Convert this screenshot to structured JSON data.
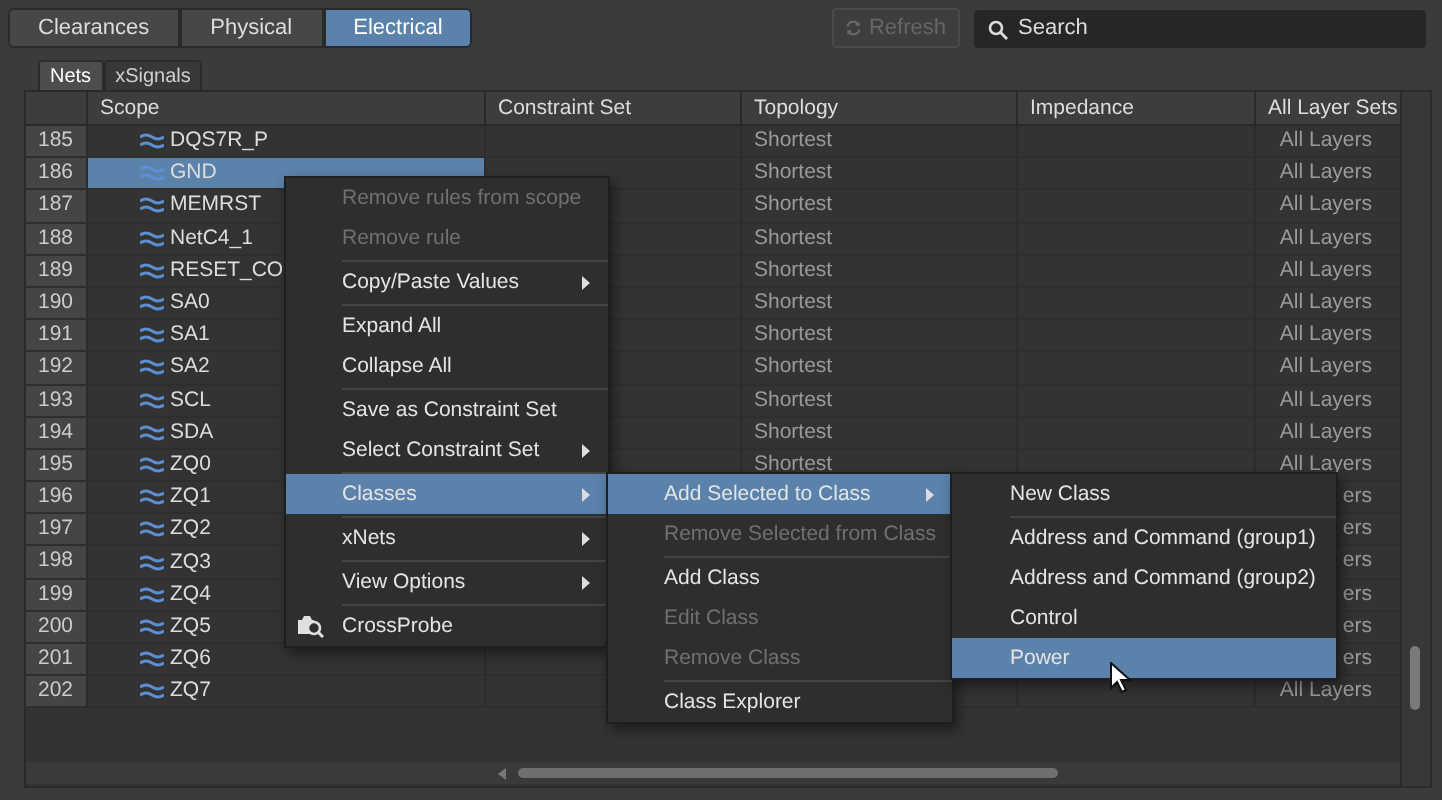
{
  "view_tabs": [
    {
      "label": "Clearances",
      "selected": false
    },
    {
      "label": "Physical",
      "selected": false
    },
    {
      "label": "Electrical",
      "selected": true
    }
  ],
  "refresh_button": {
    "label": "Refresh",
    "disabled": true
  },
  "search": {
    "placeholder": "Search"
  },
  "sub_tabs": [
    {
      "label": "Nets",
      "selected": true
    },
    {
      "label": "xSignals",
      "selected": false
    }
  ],
  "table": {
    "columns": [
      "Scope",
      "Constraint Set",
      "Topology",
      "Impedance",
      "All Layer Sets"
    ],
    "rows": [
      {
        "number": "185",
        "scope": "DQS7R_P",
        "topology": "Shortest",
        "layers": "All Layers",
        "selected": false
      },
      {
        "number": "186",
        "scope": "GND",
        "topology": "Shortest",
        "layers": "All Layers",
        "selected": true
      },
      {
        "number": "187",
        "scope": "MEMRST",
        "topology": "Shortest",
        "layers": "All Layers",
        "selected": false
      },
      {
        "number": "188",
        "scope": "NetC4_1",
        "topology": "Shortest",
        "layers": "All Layers",
        "selected": false
      },
      {
        "number": "189",
        "scope": "RESET_CO",
        "topology": "Shortest",
        "layers": "All Layers",
        "selected": false
      },
      {
        "number": "190",
        "scope": "SA0",
        "topology": "Shortest",
        "layers": "All Layers",
        "selected": false
      },
      {
        "number": "191",
        "scope": "SA1",
        "topology": "Shortest",
        "layers": "All Layers",
        "selected": false
      },
      {
        "number": "192",
        "scope": "SA2",
        "topology": "Shortest",
        "layers": "All Layers",
        "selected": false
      },
      {
        "number": "193",
        "scope": "SCL",
        "topology": "Shortest",
        "layers": "All Layers",
        "selected": false
      },
      {
        "number": "194",
        "scope": "SDA",
        "topology": "Shortest",
        "layers": "All Layers",
        "selected": false
      },
      {
        "number": "195",
        "scope": "ZQ0",
        "topology": "Shortest",
        "layers": "All Layers",
        "selected": false
      },
      {
        "number": "196",
        "scope": "ZQ1",
        "layers": "ers",
        "selected": false
      },
      {
        "number": "197",
        "scope": "ZQ2",
        "layers": "ers",
        "selected": false
      },
      {
        "number": "198",
        "scope": "ZQ3",
        "layers": "ers",
        "selected": false
      },
      {
        "number": "199",
        "scope": "ZQ4",
        "layers": "ers",
        "selected": false
      },
      {
        "number": "200",
        "scope": "ZQ5",
        "layers": "ers",
        "selected": false
      },
      {
        "number": "201",
        "scope": "ZQ6",
        "layers": "ers",
        "selected": false
      },
      {
        "number": "202",
        "scope": "ZQ7",
        "layers": "All Layers",
        "selected": false
      }
    ]
  },
  "context_menu": {
    "items": [
      {
        "kind": "item",
        "label": "Remove rules from scope",
        "disabled": true,
        "selected": false,
        "has_submenu": false
      },
      {
        "kind": "item",
        "label": "Remove rule",
        "disabled": true,
        "selected": false,
        "has_submenu": false
      },
      {
        "kind": "separator"
      },
      {
        "kind": "item",
        "label": "Copy/Paste Values",
        "disabled": false,
        "selected": false,
        "has_submenu": true
      },
      {
        "kind": "separator"
      },
      {
        "kind": "item",
        "label": "Expand All",
        "disabled": false,
        "selected": false,
        "has_submenu": false
      },
      {
        "kind": "item",
        "label": "Collapse All",
        "disabled": false,
        "selected": false,
        "has_submenu": false
      },
      {
        "kind": "separator"
      },
      {
        "kind": "item",
        "label": "Save as Constraint Set",
        "disabled": false,
        "selected": false,
        "has_submenu": false
      },
      {
        "kind": "item",
        "label": "Select Constraint Set",
        "disabled": false,
        "selected": false,
        "has_submenu": true
      },
      {
        "kind": "separator"
      },
      {
        "kind": "item",
        "label": "Classes",
        "disabled": false,
        "selected": true,
        "has_submenu": true
      },
      {
        "kind": "separator"
      },
      {
        "kind": "item",
        "label": "xNets",
        "disabled": false,
        "selected": false,
        "has_submenu": true
      },
      {
        "kind": "separator"
      },
      {
        "kind": "item",
        "label": "View Options",
        "disabled": false,
        "selected": false,
        "has_submenu": true
      },
      {
        "kind": "separator"
      },
      {
        "kind": "tool",
        "label": "CrossProbe",
        "disabled": false,
        "selected": false,
        "has_submenu": false
      }
    ]
  },
  "classes_submenu": {
    "items": [
      {
        "kind": "item",
        "label": "Add Selected to Class",
        "disabled": false,
        "selected": true,
        "has_submenu": true
      },
      {
        "kind": "item",
        "label": "Remove Selected from Class",
        "disabled": true,
        "selected": false,
        "has_submenu": false
      },
      {
        "kind": "separator"
      },
      {
        "kind": "item",
        "label": "Add Class",
        "disabled": false,
        "selected": false,
        "has_submenu": false
      },
      {
        "kind": "item",
        "label": "Edit Class",
        "disabled": true,
        "selected": false,
        "has_submenu": false
      },
      {
        "kind": "item",
        "label": "Remove Class",
        "disabled": true,
        "selected": false,
        "has_submenu": false
      },
      {
        "kind": "separator"
      },
      {
        "kind": "item",
        "label": "Class Explorer",
        "disabled": false,
        "selected": false,
        "has_submenu": false
      }
    ]
  },
  "class_list_submenu": {
    "items": [
      {
        "kind": "item",
        "label": "New Class",
        "disabled": false,
        "selected": false,
        "has_submenu": false
      },
      {
        "kind": "separator"
      },
      {
        "kind": "item",
        "label": "Address and Command (group1)",
        "disabled": false,
        "selected": false,
        "has_submenu": false
      },
      {
        "kind": "item",
        "label": "Address and Command (group2)",
        "disabled": false,
        "selected": false,
        "has_submenu": false
      },
      {
        "kind": "item",
        "label": "Control",
        "disabled": false,
        "selected": false,
        "has_submenu": false
      },
      {
        "kind": "item",
        "label": "Power",
        "disabled": false,
        "selected": true,
        "has_submenu": false
      }
    ]
  }
}
